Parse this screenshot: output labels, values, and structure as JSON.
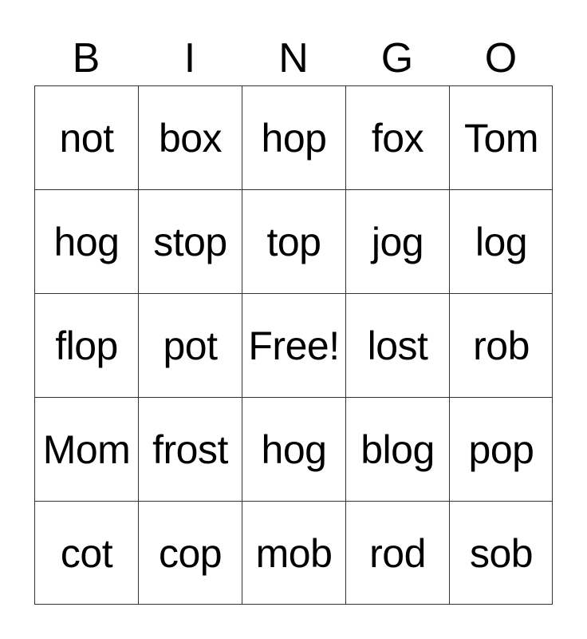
{
  "header": [
    "B",
    "I",
    "N",
    "G",
    "O"
  ],
  "cells": [
    [
      "not",
      "box",
      "hop",
      "fox",
      "Tom"
    ],
    [
      "hog",
      "stop",
      "top",
      "jog",
      "log"
    ],
    [
      "flop",
      "pot",
      "Free!",
      "lost",
      "rob"
    ],
    [
      "Mom",
      "frost",
      "hog",
      "blog",
      "pop"
    ],
    [
      "cot",
      "cop",
      "mob",
      "rod",
      "sob"
    ]
  ]
}
